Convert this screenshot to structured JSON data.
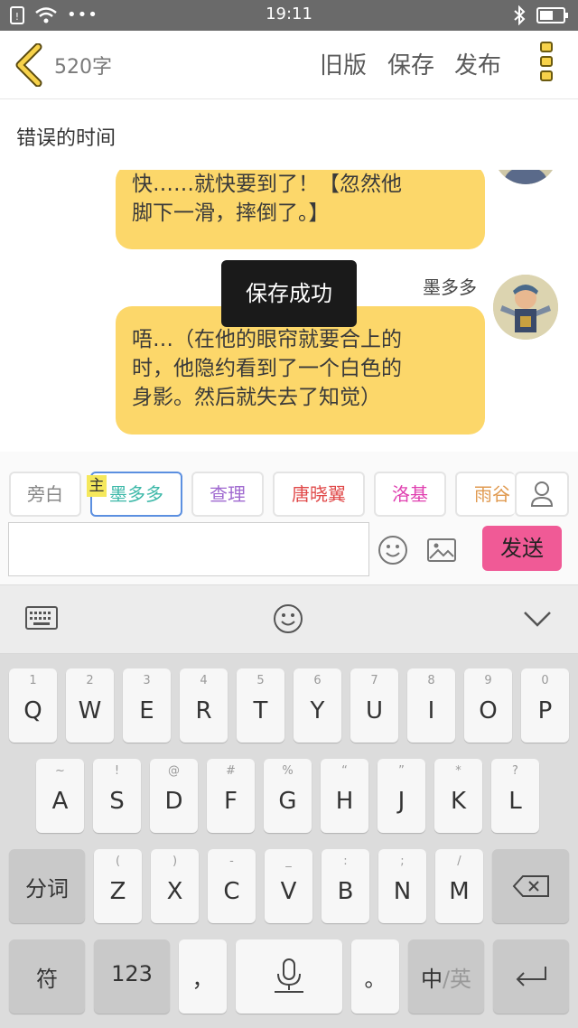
{
  "status_bar": {
    "time": "19:11"
  },
  "header": {
    "word_count": "520字",
    "old_version": "旧版",
    "save": "保存",
    "publish": "发布"
  },
  "doc_title": "错误的时间",
  "chat": {
    "bubble1_lines": [
      "快……就快要到了！【忽然他",
      "脚下一滑，摔倒了。】"
    ],
    "speaker": "墨多多",
    "bubble2_lines": [
      "唔…（在他的眼帘就要合上的",
      "时，他隐约看到了一个白色的",
      "身影。然后就失去了知觉）"
    ]
  },
  "toast": "保存成功",
  "characters": [
    {
      "label": "旁白",
      "color": "#888888"
    },
    {
      "label": "墨多多",
      "color": "#3cb8a8"
    },
    {
      "label": "查理",
      "color": "#a06ad0"
    },
    {
      "label": "唐晓翼",
      "color": "#e04848"
    },
    {
      "label": "洛基",
      "color": "#e040b0"
    },
    {
      "label": "雨谷",
      "color": "#e09a50"
    }
  ],
  "main_tag": "主",
  "composer": {
    "placeholder": "",
    "send": "发送"
  },
  "keyboard": {
    "row1": [
      [
        "1",
        "Q"
      ],
      [
        "2",
        "W"
      ],
      [
        "3",
        "E"
      ],
      [
        "4",
        "R"
      ],
      [
        "5",
        "T"
      ],
      [
        "6",
        "Y"
      ],
      [
        "7",
        "U"
      ],
      [
        "8",
        "I"
      ],
      [
        "9",
        "O"
      ],
      [
        "0",
        "P"
      ]
    ],
    "row2": [
      [
        "~",
        "A"
      ],
      [
        "!",
        "S"
      ],
      [
        "@",
        "D"
      ],
      [
        "#",
        "F"
      ],
      [
        "%",
        "G"
      ],
      [
        "“",
        "H"
      ],
      [
        "”",
        "J"
      ],
      [
        "*",
        "K"
      ],
      [
        "?",
        "L"
      ]
    ],
    "row3": [
      [
        "(",
        "Z"
      ],
      [
        ")",
        "X"
      ],
      [
        "-",
        "C"
      ],
      [
        "_",
        "V"
      ],
      [
        ":",
        "B"
      ],
      [
        ";",
        "N"
      ],
      [
        "/",
        "M"
      ]
    ],
    "segment": "分词",
    "symbols": "符",
    "numbers": "123",
    "comma": "，",
    "period": "。",
    "lang_cn": "中",
    "lang_sep": "/",
    "lang_en": "英"
  }
}
